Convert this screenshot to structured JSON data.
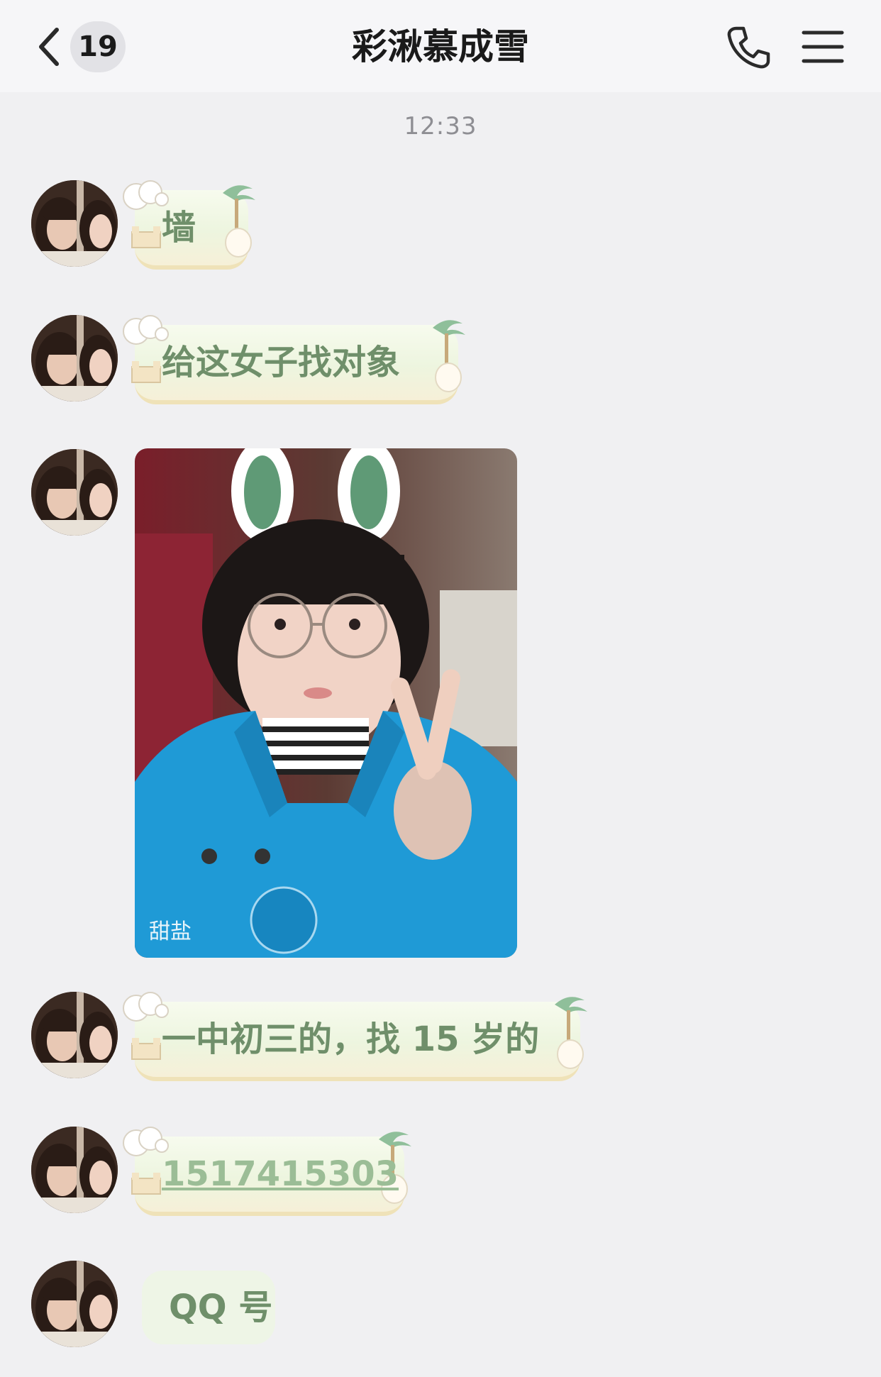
{
  "header": {
    "unread_count": "19",
    "title": "彩湫慕成雪",
    "back_icon": "chevron-left-icon",
    "call_icon": "phone-icon",
    "menu_icon": "hamburger-menu-icon"
  },
  "timestamp": "12:33",
  "messages": [
    {
      "type": "text",
      "text": "墙"
    },
    {
      "type": "text",
      "text": "给这女子找对象"
    },
    {
      "type": "image",
      "watermark": "甜盐",
      "description_icon": "photo-girl-bunny-ears"
    },
    {
      "type": "text",
      "text": "一中初三的，找 15 岁的"
    },
    {
      "type": "text",
      "text": "1517415303"
    },
    {
      "type": "text",
      "text": "QQ 号"
    }
  ],
  "colors": {
    "background": "#f0f0f2",
    "header": "#f6f6f8",
    "bubble_text": "#6f8f6a",
    "badge": "#e2e2e6"
  }
}
